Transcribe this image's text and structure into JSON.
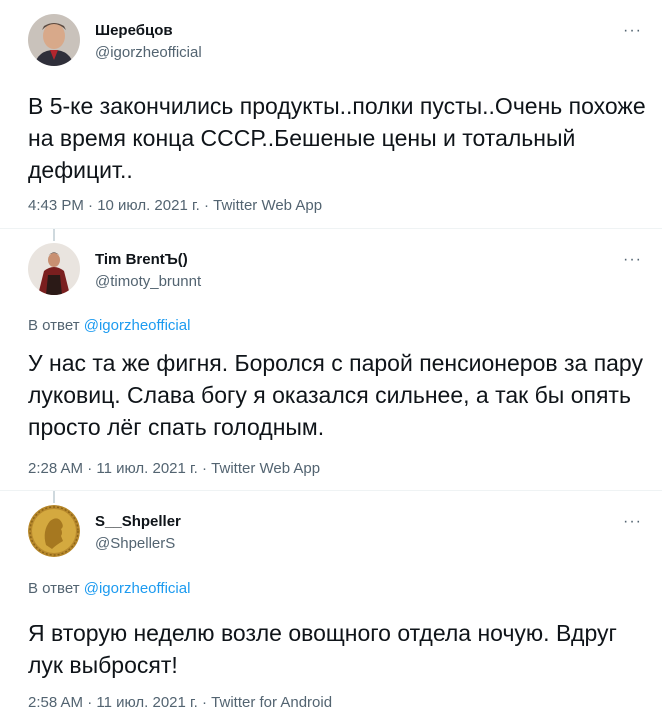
{
  "tweets": [
    {
      "name": "Шеребцов",
      "handle": "@igorzheofficial",
      "more_icon": "more-horizontal-icon",
      "text": "В 5-ке закончились продукты..полки пусты..Очень похоже на время конца СССР..Бешеные цены и тотальный дефицит..",
      "meta": "4:43 PM · 10 июл. 2021 г. · Twitter Web App"
    },
    {
      "name": "Tim BrentЪ()",
      "handle": "@timoty_brunnt",
      "reply_prefix": "В ответ",
      "reply_mention": "@igorzheofficial",
      "text": "У нас та же фигня. Боролся с парой пенсионеров за пару луковиц. Слава богу я  оказался сильнее, а так бы опять просто лёг спать голодным.",
      "meta": "2:28 AM · 11 июл. 2021 г. · Twitter Web App"
    },
    {
      "name": "S__Shpeller",
      "handle": "@ShpellerS",
      "reply_prefix": "В ответ",
      "reply_mention": "@igorzheofficial",
      "text": "Я вторую неделю возле овощного отдела ночую. Вдруг лук выбросят!",
      "meta": "2:58 AM · 11 июл. 2021 г. · Twitter for Android"
    }
  ],
  "more_glyph": "···"
}
